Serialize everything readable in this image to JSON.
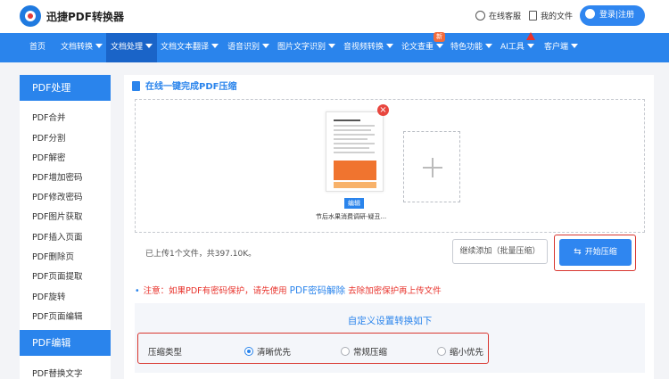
{
  "header": {
    "brand": "迅捷PDF转换器",
    "support": "在线客服",
    "my_files": "我的文件",
    "login": "登录|注册"
  },
  "nav": {
    "items": [
      {
        "label": "首页"
      },
      {
        "label": "文档转换"
      },
      {
        "label": "文档处理"
      },
      {
        "label": "文档文本翻译"
      },
      {
        "label": "语音识别"
      },
      {
        "label": "图片文字识别"
      },
      {
        "label": "音视频转换"
      },
      {
        "label": "论文查重"
      },
      {
        "label": "特色功能"
      },
      {
        "label": "AI工具"
      },
      {
        "label": "客户端"
      }
    ],
    "new_badge": "新"
  },
  "sidebar": {
    "section1": "PDF处理",
    "items": [
      "PDF合并",
      "PDF分割",
      "PDF解密",
      "PDF增加密码",
      "PDF修改密码",
      "PDF图片获取",
      "PDF插入页面",
      "PDF删除页",
      "PDF页面提取",
      "PDF旋转",
      "PDF页面编辑"
    ],
    "section2": "PDF编辑",
    "items2": [
      "PDF替换文字"
    ]
  },
  "main": {
    "title": "在线一键完成PDF压缩",
    "file": {
      "edit_label": "编辑",
      "name": "节后水果消费调研-疑丑..."
    },
    "upload_info": "已上传1个文件，共397.10K。",
    "continue_label": "继续添加（批量压缩）",
    "start_label": "开始压缩",
    "notice": {
      "prefix": "注意：如果PDF有密码保护，请先使用",
      "link": "PDF密码解除",
      "suffix": "去除加密保护再上传文件"
    },
    "settings": {
      "title": "自定义设置转换如下",
      "label": "压缩类型",
      "options": [
        {
          "label": "清晰优先",
          "checked": true
        },
        {
          "label": "常规压缩",
          "checked": false
        },
        {
          "label": "缩小优先",
          "checked": false
        }
      ]
    }
  },
  "colors": {
    "accent": "#2a84ec",
    "highlight": "#d9362f"
  }
}
